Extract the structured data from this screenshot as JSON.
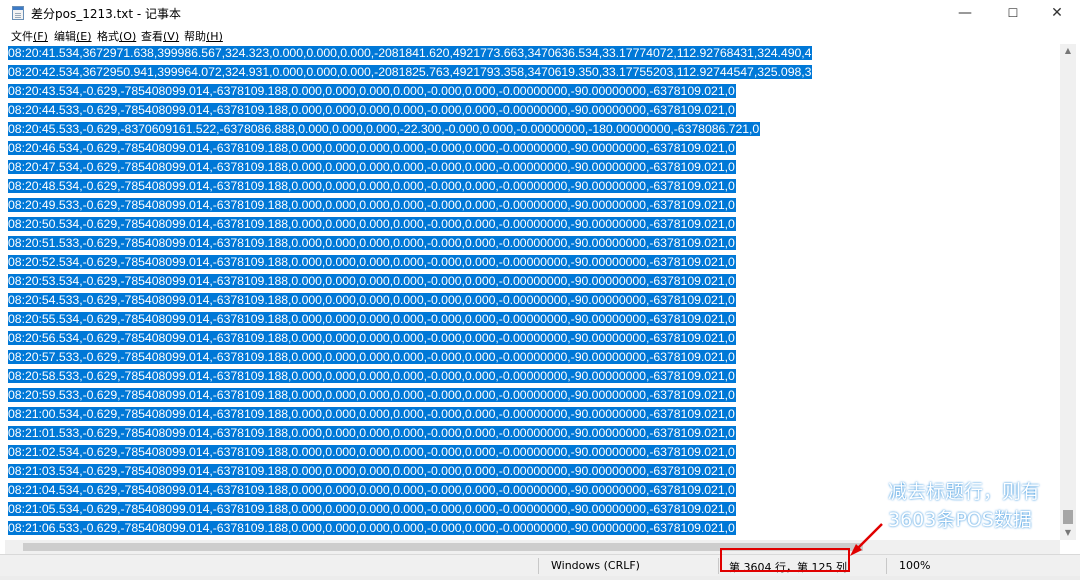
{
  "window": {
    "title": "差分pos_1213.txt - 记事本",
    "minimize_glyph": "—",
    "maximize_glyph": "☐",
    "close_glyph": "✕"
  },
  "menu": [
    {
      "label": "文件",
      "key": "(F)"
    },
    {
      "label": "编辑",
      "key": "(E)"
    },
    {
      "label": "格式",
      "key": "(O)"
    },
    {
      "label": "查看",
      "key": "(V)"
    },
    {
      "label": "帮助",
      "key": "(H)"
    }
  ],
  "lines": [
    "08:20:41.534,3672971.638,399986.567,324.323,0.000,0.000,0.000,-2081841.620,4921773.663,3470636.534,33.17774072,112.92768431,324.490,4",
    "08:20:42.534,3672950.941,399964.072,324.931,0.000,0.000,0.000,-2081825.763,4921793.358,3470619.350,33.17755203,112.92744547,325.098,3",
    "08:20:43.534,-0.629,-785408099.014,-6378109.188,0.000,0.000,0.000,0.000,-0.000,0.000,-0.00000000,-90.00000000,-6378109.021,0",
    "08:20:44.533,-0.629,-785408099.014,-6378109.188,0.000,0.000,0.000,0.000,-0.000,0.000,-0.00000000,-90.00000000,-6378109.021,0",
    "08:20:45.533,-0.629,-8370609161.522,-6378086.888,0.000,0.000,0.000,-22.300,-0.000,0.000,-0.00000000,-180.00000000,-6378086.721,0",
    "08:20:46.534,-0.629,-785408099.014,-6378109.188,0.000,0.000,0.000,0.000,-0.000,0.000,-0.00000000,-90.00000000,-6378109.021,0",
    "08:20:47.534,-0.629,-785408099.014,-6378109.188,0.000,0.000,0.000,0.000,-0.000,0.000,-0.00000000,-90.00000000,-6378109.021,0",
    "08:20:48.534,-0.629,-785408099.014,-6378109.188,0.000,0.000,0.000,0.000,-0.000,0.000,-0.00000000,-90.00000000,-6378109.021,0",
    "08:20:49.533,-0.629,-785408099.014,-6378109.188,0.000,0.000,0.000,0.000,-0.000,0.000,-0.00000000,-90.00000000,-6378109.021,0",
    "08:20:50.534,-0.629,-785408099.014,-6378109.188,0.000,0.000,0.000,0.000,-0.000,0.000,-0.00000000,-90.00000000,-6378109.021,0",
    "08:20:51.533,-0.629,-785408099.014,-6378109.188,0.000,0.000,0.000,0.000,-0.000,0.000,-0.00000000,-90.00000000,-6378109.021,0",
    "08:20:52.534,-0.629,-785408099.014,-6378109.188,0.000,0.000,0.000,0.000,-0.000,0.000,-0.00000000,-90.00000000,-6378109.021,0",
    "08:20:53.534,-0.629,-785408099.014,-6378109.188,0.000,0.000,0.000,0.000,-0.000,0.000,-0.00000000,-90.00000000,-6378109.021,0",
    "08:20:54.533,-0.629,-785408099.014,-6378109.188,0.000,0.000,0.000,0.000,-0.000,0.000,-0.00000000,-90.00000000,-6378109.021,0",
    "08:20:55.534,-0.629,-785408099.014,-6378109.188,0.000,0.000,0.000,0.000,-0.000,0.000,-0.00000000,-90.00000000,-6378109.021,0",
    "08:20:56.534,-0.629,-785408099.014,-6378109.188,0.000,0.000,0.000,0.000,-0.000,0.000,-0.00000000,-90.00000000,-6378109.021,0",
    "08:20:57.533,-0.629,-785408099.014,-6378109.188,0.000,0.000,0.000,0.000,-0.000,0.000,-0.00000000,-90.00000000,-6378109.021,0",
    "08:20:58.533,-0.629,-785408099.014,-6378109.188,0.000,0.000,0.000,0.000,-0.000,0.000,-0.00000000,-90.00000000,-6378109.021,0",
    "08:20:59.533,-0.629,-785408099.014,-6378109.188,0.000,0.000,0.000,0.000,-0.000,0.000,-0.00000000,-90.00000000,-6378109.021,0",
    "08:21:00.534,-0.629,-785408099.014,-6378109.188,0.000,0.000,0.000,0.000,-0.000,0.000,-0.00000000,-90.00000000,-6378109.021,0",
    "08:21:01.533,-0.629,-785408099.014,-6378109.188,0.000,0.000,0.000,0.000,-0.000,0.000,-0.00000000,-90.00000000,-6378109.021,0",
    "08:21:02.534,-0.629,-785408099.014,-6378109.188,0.000,0.000,0.000,0.000,-0.000,0.000,-0.00000000,-90.00000000,-6378109.021,0",
    "08:21:03.534,-0.629,-785408099.014,-6378109.188,0.000,0.000,0.000,0.000,-0.000,0.000,-0.00000000,-90.00000000,-6378109.021,0",
    "08:21:04.534,-0.629,-785408099.014,-6378109.188,0.000,0.000,0.000,0.000,-0.000,0.000,-0.00000000,-90.00000000,-6378109.021,0",
    "08:21:05.534,-0.629,-785408099.014,-6378109.188,0.000,0.000,0.000,0.000,-0.000,0.000,-0.00000000,-90.00000000,-6378109.021,0",
    "08:21:06.533,-0.629,-785408099.014,-6378109.188,0.000,0.000,0.000,0.000,-0.000,0.000,-0.00000000,-90.00000000,-6378109.021,0"
  ],
  "status": {
    "line_ending": "Windows (CRLF)",
    "position": "第 3604 行，第 125 列",
    "zoom": "100%"
  },
  "annotation": {
    "line1": "减去标题行，则有",
    "line2": "3603条POS数据",
    "highlight_color": "#e00000"
  },
  "colors": {
    "selection": "#0078d7",
    "selection_text": "#ffffff"
  }
}
